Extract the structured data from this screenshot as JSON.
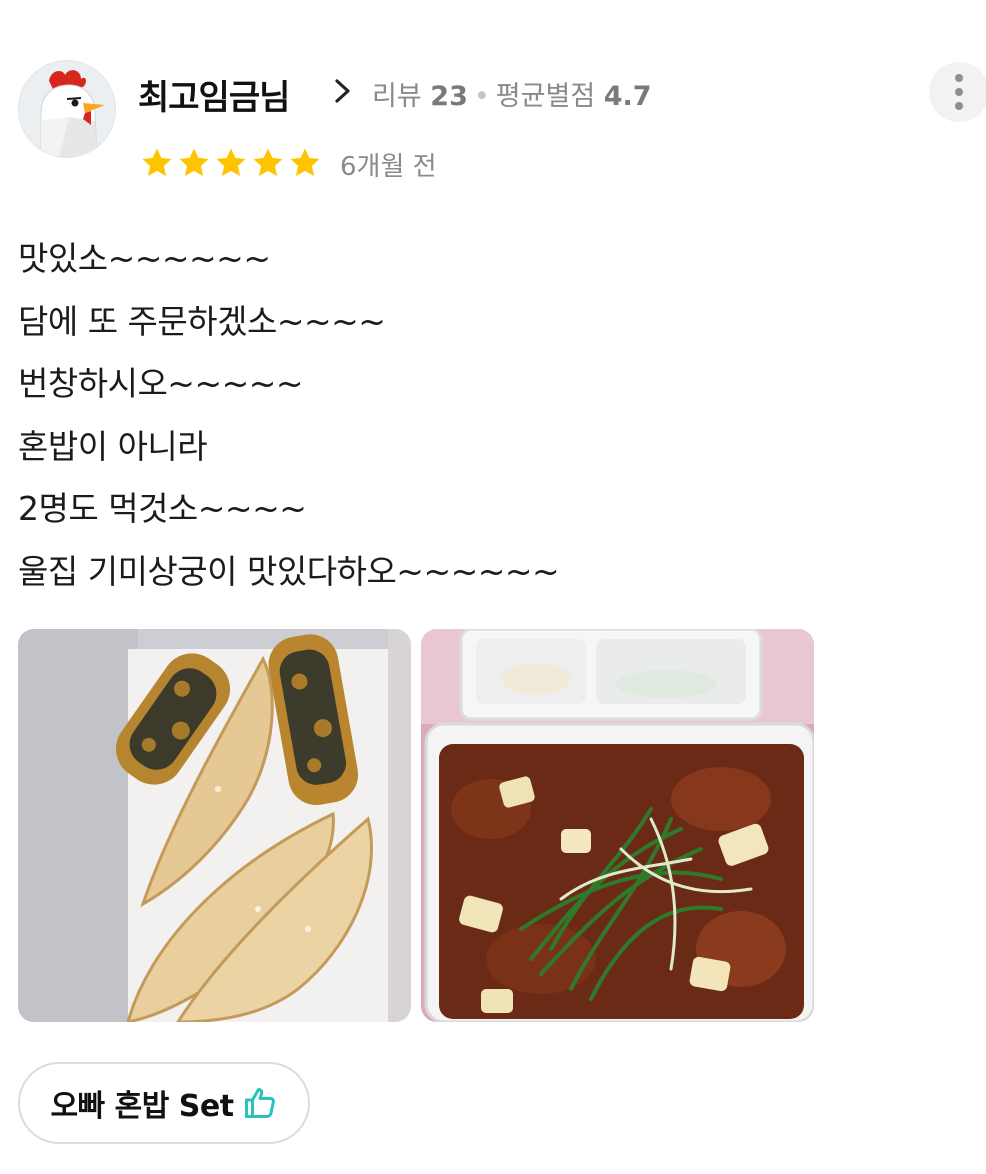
{
  "review": {
    "username": "최고임금님",
    "review_label": "리뷰",
    "review_count": "23",
    "separator": "•",
    "avg_label": "평균별점",
    "avg_rating": "4.7",
    "rating_stars": 5,
    "date": "6개월 전",
    "lines": [
      "맛있소~~~~~~",
      "담에 또 주문하겠소~~~~",
      "번창하시오~~~~~",
      "혼밥이 아니라",
      "2명도 먹것소~~~~",
      "울집 기미상궁이 맛있다하오~~~~~~"
    ]
  },
  "menu_tag": {
    "label": "오빠 혼밥 Set",
    "icon": "thumbs-up-icon"
  },
  "colors": {
    "star": "#FFC400",
    "tag_icon": "#2BC1BC",
    "meta_text": "#8A8A8A"
  }
}
